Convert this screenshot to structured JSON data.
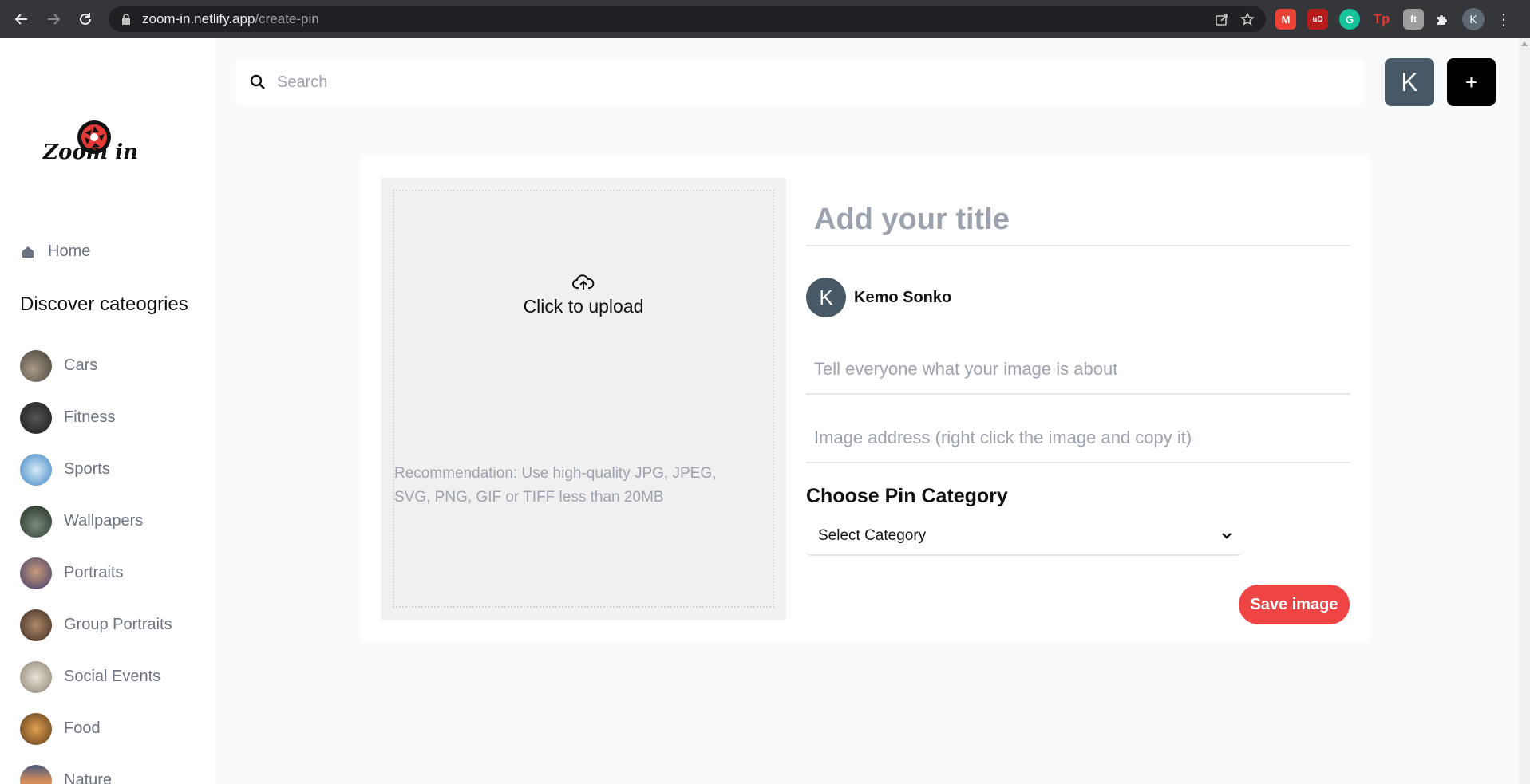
{
  "browser": {
    "url_host": "zoom-in.netlify.app",
    "url_path": "/create-pin",
    "profile_initial": "K",
    "extensions": [
      {
        "name": "gmail-extension-icon",
        "label": "M",
        "color": "#ea4335"
      },
      {
        "name": "ublock-extension-icon",
        "label": "uD",
        "color": "#b71c1c"
      },
      {
        "name": "grammarly-extension-icon",
        "label": "G",
        "color": "#15c39a"
      },
      {
        "name": "tp-extension-icon",
        "label": "Tp",
        "color": "#e53935"
      },
      {
        "name": "font-extension-icon",
        "label": "ft",
        "color": "#9e9e9e"
      }
    ]
  },
  "sidebar": {
    "logo_text": "Zoom in",
    "home_label": "Home",
    "categories_heading": "Discover cateogries",
    "categories": [
      {
        "label": "Cars",
        "color": "#6b6457"
      },
      {
        "label": "Fitness",
        "color": "#2b2b2b"
      },
      {
        "label": "Sports",
        "color": "#5aa0d6"
      },
      {
        "label": "Wallpapers",
        "color": "#3a4a3a"
      },
      {
        "label": "Portraits",
        "color": "#6a5b8c"
      },
      {
        "label": "Group Portraits",
        "color": "#7a5a45"
      },
      {
        "label": "Social Events",
        "color": "#b9b2a6"
      },
      {
        "label": "Food",
        "color": "#8c5a2a"
      },
      {
        "label": "Nature",
        "color": "#c98a5a"
      }
    ]
  },
  "header": {
    "search_placeholder": "Search",
    "avatar_initial": "K",
    "add_label": "+"
  },
  "create_pin": {
    "upload_cta": "Click to upload",
    "upload_note": "Recommendation: Use high-quality JPG, JPEG, SVG, PNG, GIF or TIFF less than 20MB",
    "title_placeholder": "Add your title",
    "user_initial": "K",
    "user_name": "Kemo Sonko",
    "about_placeholder": "Tell everyone what your image is about",
    "address_placeholder": "Image address (right click the image and copy it)",
    "category_label": "Choose Pin Category",
    "category_selected": "Select Category",
    "save_label": "Save image"
  },
  "colors": {
    "accent": "#ef4444",
    "avatar": "#475866"
  }
}
